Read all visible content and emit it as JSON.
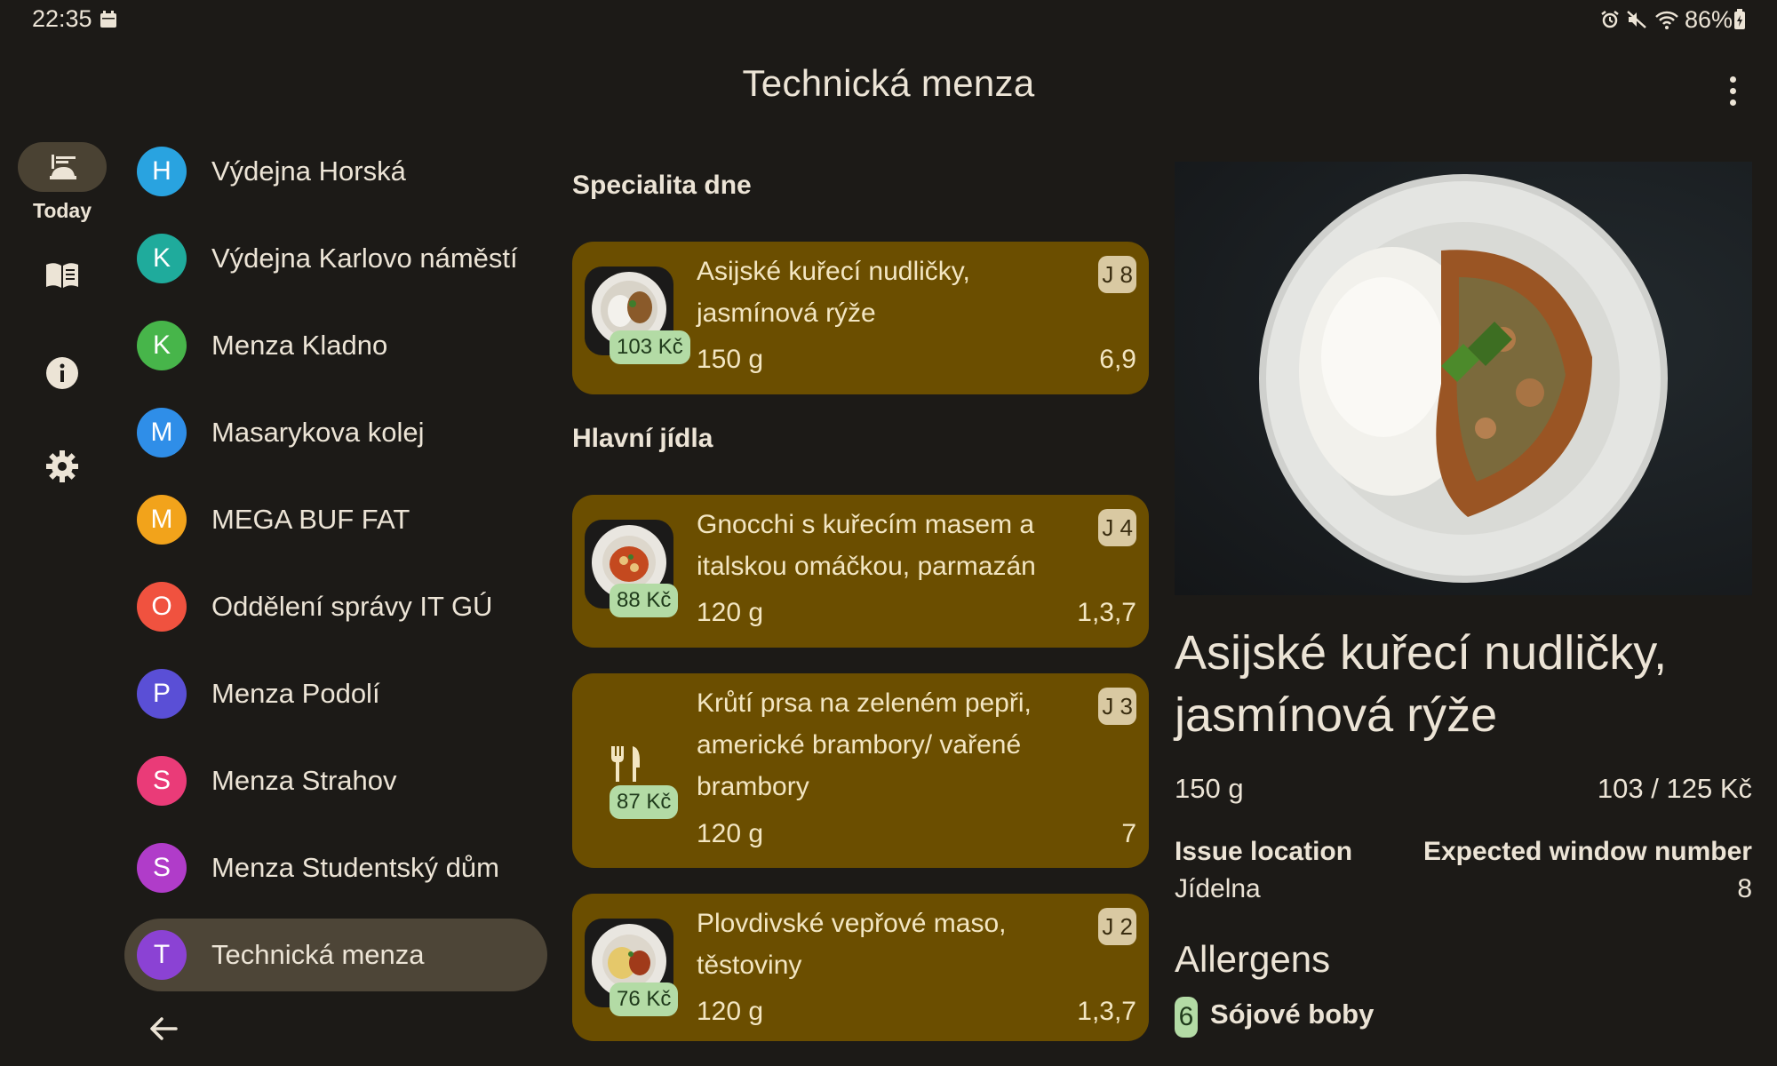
{
  "status_bar": {
    "time": "22:35",
    "battery": "86%",
    "icons": [
      "calendar-icon",
      "alarm-icon",
      "mute-icon",
      "wifi-icon",
      "battery-icon"
    ]
  },
  "app_bar": {
    "title": "Technická menza",
    "menu_icon": "more-vert-icon"
  },
  "rail": {
    "items": [
      {
        "label": "Today",
        "icon": "food-today-icon",
        "active": true
      },
      {
        "label": "",
        "icon": "menu-book-icon"
      },
      {
        "label": "",
        "icon": "info-icon"
      },
      {
        "label": "",
        "icon": "settings-icon"
      }
    ]
  },
  "canteens": [
    {
      "initial": "H",
      "name": "Výdejna Horská",
      "color": "#29a3e0"
    },
    {
      "initial": "K",
      "name": "Výdejna Karlovo náměstí",
      "color": "#1fab9c"
    },
    {
      "initial": "K",
      "name": "Menza Kladno",
      "color": "#47b54a"
    },
    {
      "initial": "M",
      "name": "Masarykova kolej",
      "color": "#2f8ee8"
    },
    {
      "initial": "M",
      "name": "MEGA BUF FAT",
      "color": "#f2a31b"
    },
    {
      "initial": "O",
      "name": "Oddělení správy IT GÚ",
      "color": "#f0523f"
    },
    {
      "initial": "P",
      "name": "Menza Podolí",
      "color": "#5a4fd6"
    },
    {
      "initial": "S",
      "name": "Menza Strahov",
      "color": "#ea3b78"
    },
    {
      "initial": "S",
      "name": "Menza Studentský dům",
      "color": "#b03cc9"
    },
    {
      "initial": "T",
      "name": "Technická menza",
      "color": "#8b42d4",
      "selected": true
    }
  ],
  "sections": {
    "special": "Specialita dne",
    "main": "Hlavní jídla"
  },
  "dishes": [
    {
      "name": "Asijské kuřecí nudličky, jasmínová rýže",
      "price": "103 Kč",
      "weight": "150 g",
      "allergens": "6,9",
      "window": "J 8",
      "thumb": "photo"
    },
    {
      "name": "Gnocchi s kuřecím masem a italskou omáčkou, parmazán",
      "price": "88 Kč",
      "weight": "120 g",
      "allergens": "1,3,7",
      "window": "J 4",
      "thumb": "photo"
    },
    {
      "name": "Krůtí prsa na zeleném pepři, americké brambory/ vařené brambory",
      "price": "87 Kč",
      "weight": "120 g",
      "allergens": "7",
      "window": "J 3",
      "thumb": "cutlery-icon"
    },
    {
      "name": "Plovdivské vepřové maso, těstoviny",
      "price": "76 Kč",
      "weight": "120 g",
      "allergens": "1,3,7",
      "window": "J 2",
      "thumb": "photo"
    }
  ],
  "detail": {
    "title": "Asijské kuřecí nudličky, jasmínová rýže",
    "weight": "150 g",
    "price": "103 / 125 Kč",
    "issue_location_label": "Issue location",
    "issue_location": "Jídelna",
    "window_label": "Expected window number",
    "window": "8",
    "allergens_heading": "Allergens",
    "allergens": [
      {
        "number": "6",
        "name": "Sójové boby"
      }
    ]
  },
  "colors": {
    "background": "#1c1a17",
    "card": "#6b4e00",
    "price_badge": "#b3dba5",
    "selected_item": "#4d4537"
  }
}
